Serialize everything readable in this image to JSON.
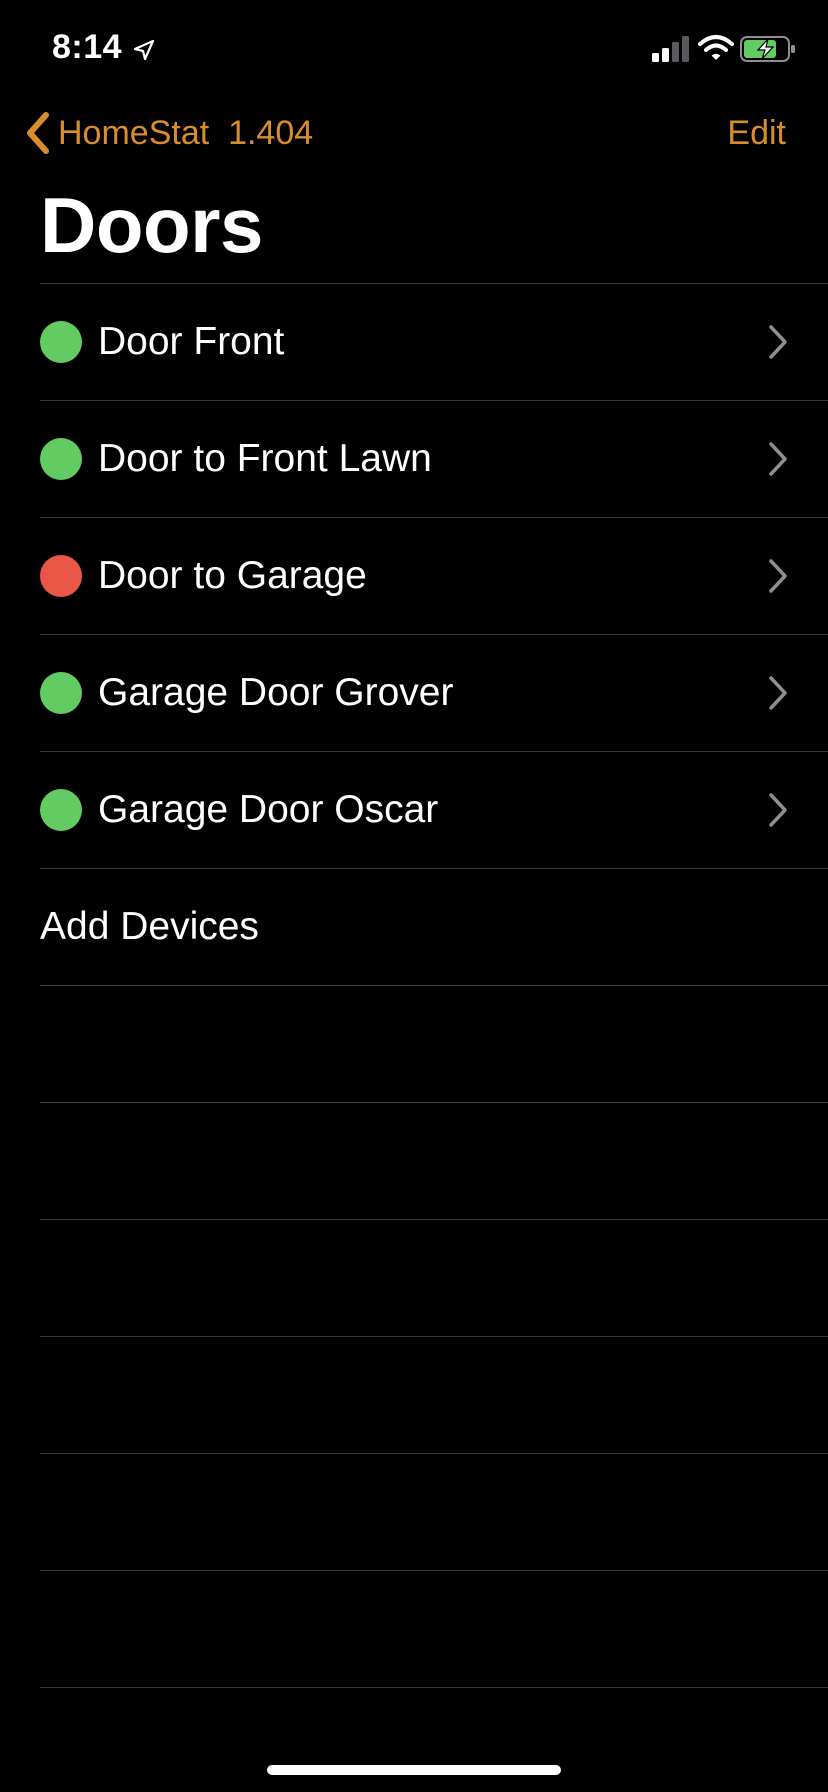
{
  "status_bar": {
    "time": "8:14",
    "location_icon": "location-arrow-icon",
    "signal_icon": "cellular-signal-icon",
    "wifi_icon": "wifi-icon",
    "battery_icon": "battery-charging-icon"
  },
  "nav": {
    "back_label": "HomeStat  1.404",
    "edit_label": "Edit",
    "accent_color": "#d98d2c"
  },
  "title": "Doors",
  "doors": [
    {
      "name": "Door Front",
      "status_color": "#62cc63"
    },
    {
      "name": "Door to Front Lawn",
      "status_color": "#62cc63"
    },
    {
      "name": "Door to Garage",
      "status_color": "#eb5747"
    },
    {
      "name": "Garage Door Grover",
      "status_color": "#62cc63"
    },
    {
      "name": "Garage Door Oscar",
      "status_color": "#62cc63"
    }
  ],
  "add_devices_label": "Add Devices",
  "colors": {
    "background": "#000000",
    "separator": "#38383a",
    "text": "#ffffff",
    "chevron": "#8e8e93"
  }
}
